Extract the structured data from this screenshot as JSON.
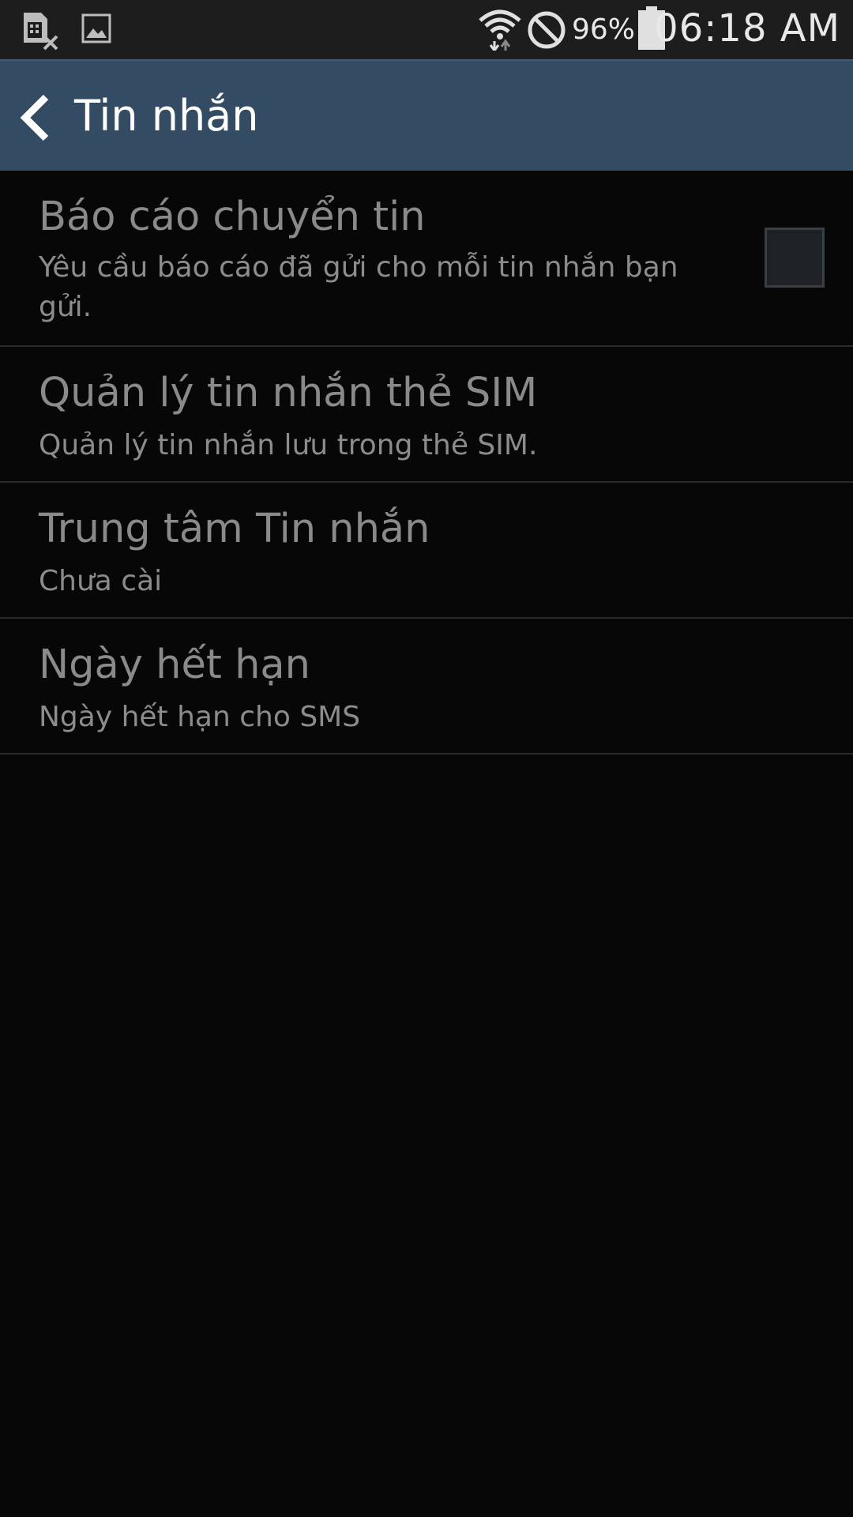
{
  "status_bar": {
    "icons": [
      "sim-card-error-icon",
      "gallery-icon",
      "wifi-data-icon",
      "no-sign-icon",
      "battery-icon"
    ],
    "battery_percent": "96%",
    "time": "06:18 AM"
  },
  "action_bar": {
    "title": "Tin nhắn",
    "back_icon": "chevron-left-icon"
  },
  "settings": [
    {
      "title": "Báo cáo chuyển tin",
      "subtitle": "Yêu cầu báo cáo đã gửi cho mỗi tin nhắn bạn gửi.",
      "checkbox_checked": false
    },
    {
      "title": "Quản lý tin nhắn thẻ SIM",
      "subtitle": "Quản lý tin nhắn lưu trong thẻ SIM."
    },
    {
      "title": "Trung tâm Tin nhắn",
      "subtitle": "Chưa cài"
    },
    {
      "title": "Ngày hết hạn",
      "subtitle": "Ngày hết hạn cho SMS"
    }
  ],
  "colors": {
    "status_bar_bg": "#1d1d1d",
    "action_bar_bg": "#334b63",
    "background": "#070707",
    "divider": "#2a2a2a"
  }
}
